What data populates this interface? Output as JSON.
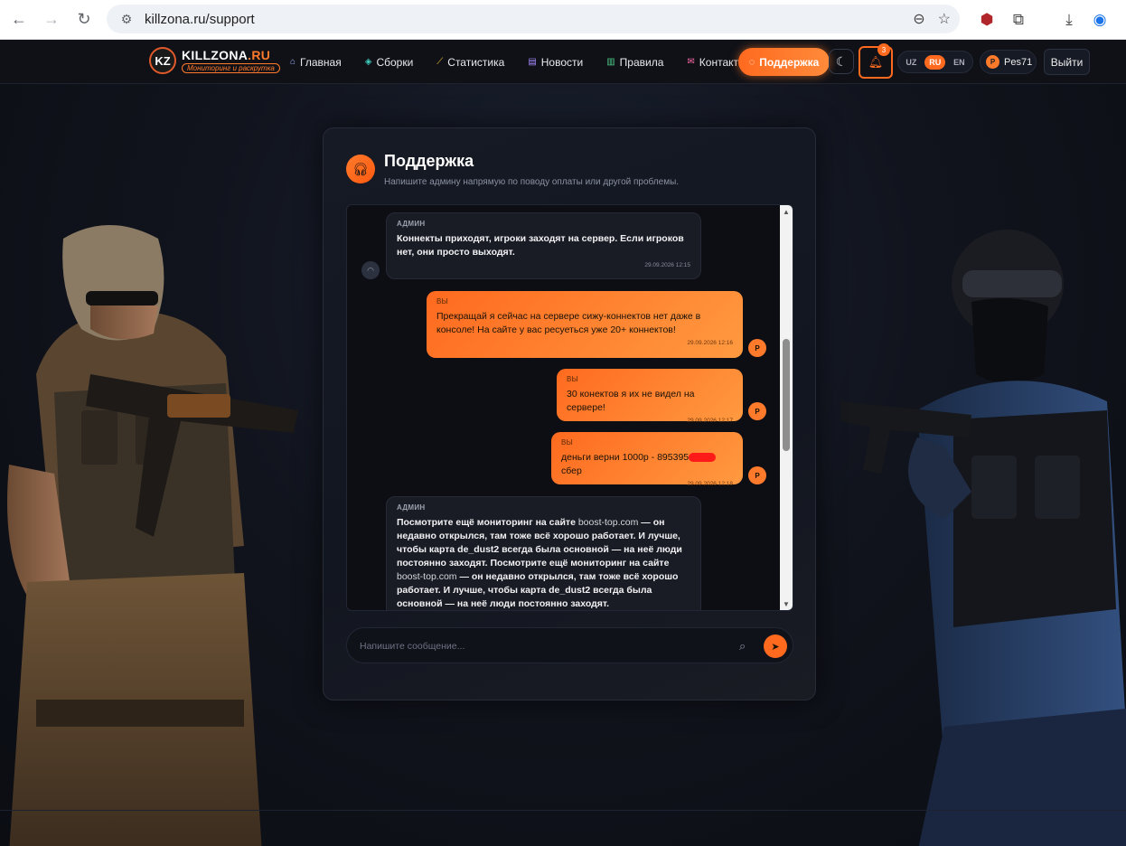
{
  "browser": {
    "url": "killzona.ru/support"
  },
  "header": {
    "logo_badge": "KZ",
    "logo_title_main": "KILLZONA",
    "logo_title_accent": ".RU",
    "logo_subtitle": "Мониторинг и раскрутка",
    "menu": [
      {
        "label": "Главная",
        "icon": "home-icon",
        "color": "#9fb4ff"
      },
      {
        "label": "Сборки",
        "icon": "cube-icon",
        "color": "#3fd0c0"
      },
      {
        "label": "Статистика",
        "icon": "chart-icon",
        "color": "#f2c230"
      },
      {
        "label": "Новости",
        "icon": "news-icon",
        "color": "#a98bff"
      },
      {
        "label": "Правила",
        "icon": "document-icon",
        "color": "#4fd08a"
      },
      {
        "label": "Контакты",
        "icon": "mail-icon",
        "color": "#ff6aa8"
      }
    ],
    "support_label": "Поддержка",
    "notification_count": "3",
    "languages": [
      "UZ",
      "RU",
      "EN"
    ],
    "active_language": "RU",
    "user_initial": "P",
    "user_name": "Pes71",
    "logout_label": "Выйти"
  },
  "support": {
    "title": "Поддержка",
    "subtitle": "Напишите админу напрямую по поводу оплаты или другой проблемы.",
    "messages": [
      {
        "from": "admin",
        "author": "АДМИН",
        "text": "Коннекты приходят, игроки заходят на сервер. Если игроков нет, они просто выходят.",
        "time": "29.09.2026 12:15"
      },
      {
        "from": "you",
        "author": "ВЫ",
        "text": "Прекращай я сейчас на сервере сижу-коннектов нет даже в консоле! На сайте у вас ресуеться уже 20+ коннектов!",
        "time": "29.09.2026 12:16"
      },
      {
        "from": "you",
        "author": "ВЫ",
        "text": "30 конектов я их не видел на сервере!",
        "time": "29.09.2026 12:17"
      },
      {
        "from": "you",
        "author": "ВЫ",
        "text_before": "деньги верни 1000р - 895395",
        "text_after": "сбер",
        "time": "29.09.2026 12:18"
      },
      {
        "from": "admin",
        "author": "АДМИН",
        "text_parts": [
          "Посмотрите ещё мониторинг на сайте ",
          "boost-top.com",
          " — он недавно открылся, там тоже всё хорошо работает. И лучше, чтобы карта de_dust2 всегда была основной — на неё люди постоянно заходят. Посмотрите ещё мониторинг на сайте ",
          "boost-top.com",
          " — он недавно открылся, там тоже всё хорошо работает. И лучше, чтобы карта de_dust2 всегда была основной — на неё люди постоянно заходят."
        ]
      }
    ],
    "input_placeholder": "Напишите сообщение..."
  },
  "colors": {
    "accent": "#ff6a1f",
    "background": "#0d0f15"
  }
}
